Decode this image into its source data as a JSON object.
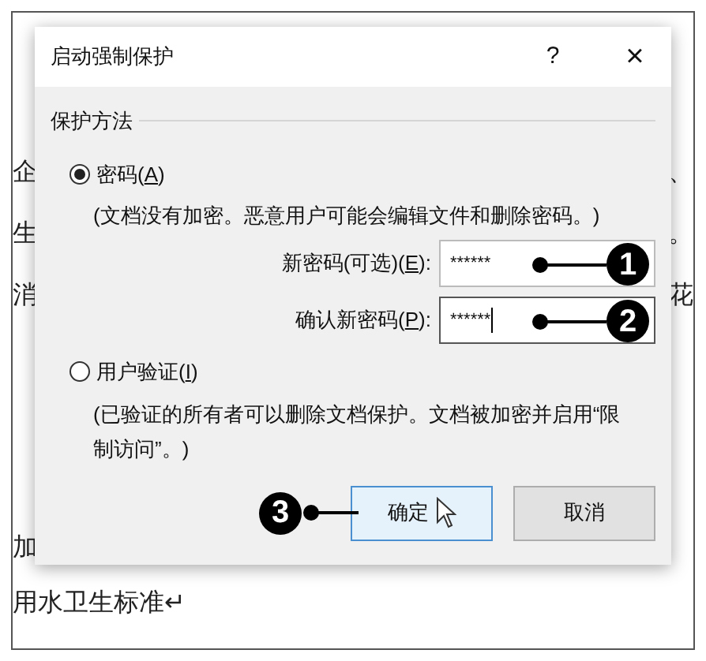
{
  "document": {
    "upper_left": [
      "企",
      "生",
      "消"
    ],
    "right_fragments": [
      "、",
      "。",
      "花"
    ],
    "lower_lines": [
      "加",
      "用水卫生标准↵"
    ]
  },
  "dialog": {
    "title": "启动强制保护",
    "help": "?",
    "close": "×",
    "group_label": "保护方法",
    "options": [
      {
        "label_start": "密码(",
        "access_key": "A",
        "label_end": ")",
        "selected": true,
        "description": "(文档没有加密。恶意用户可能会编辑文件和删除密码。)"
      },
      {
        "label_start": "用户验证(",
        "access_key": "I",
        "label_end": ")",
        "selected": false,
        "description": "(已验证的所有者可以删除文档保护。文档被加密并启用“限制访问”。)"
      }
    ],
    "fields": [
      {
        "label_start": "新密码(可选)(",
        "access_key": "E",
        "label_end": "):",
        "value": "******",
        "focused": false,
        "callout": "1"
      },
      {
        "label_start": "确认新密码(",
        "access_key": "P",
        "label_end": "):",
        "value": "******",
        "focused": true,
        "callout": "2"
      }
    ],
    "buttons": [
      {
        "label": "确定",
        "default": true,
        "callout": "3"
      },
      {
        "label": "取消",
        "default": false
      }
    ]
  }
}
